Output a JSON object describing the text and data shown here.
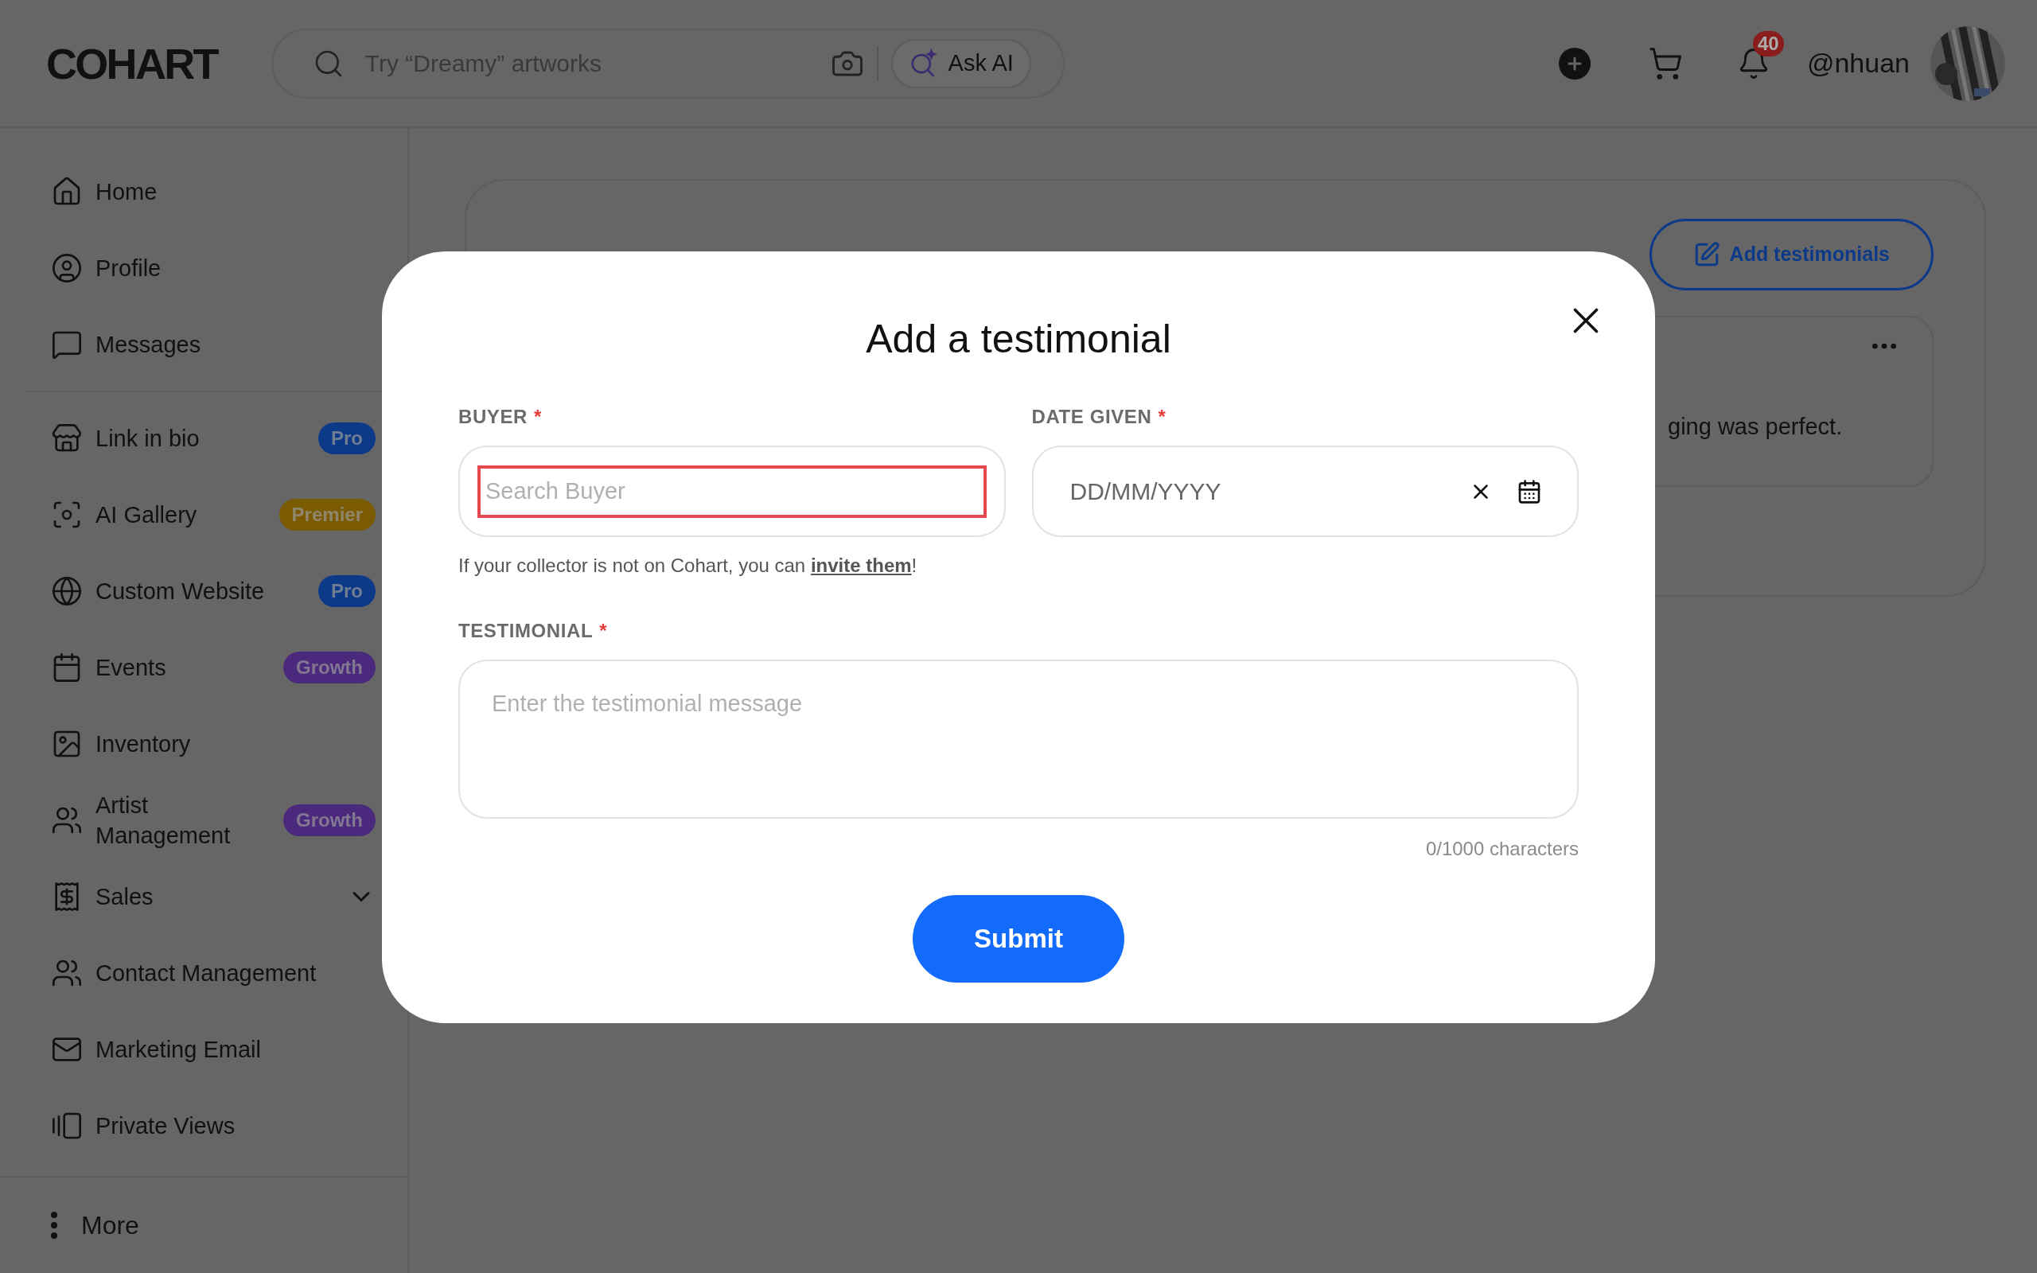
{
  "header": {
    "logo": "COHART",
    "search_placeholder": "Try “Dreamy” artworks",
    "ask_ai": "Ask AI",
    "notification_count": "40",
    "username": "@nhuan"
  },
  "sidebar": {
    "sections": [
      [
        {
          "label": "Home",
          "kind": "link"
        },
        {
          "label": "Profile",
          "kind": "link"
        },
        {
          "label": "Messages",
          "kind": "link"
        }
      ],
      [
        {
          "label": "Link in bio",
          "kind": "link",
          "badge": {
            "text": "Pro",
            "color": "#0c3a89"
          }
        },
        {
          "label": "AI Gallery",
          "kind": "link",
          "badge": {
            "text": "Premier",
            "color": "#7a5b02"
          }
        },
        {
          "label": "Custom Website",
          "kind": "link",
          "badge": {
            "text": "Pro",
            "color": "#0c3a89"
          }
        },
        {
          "label": "Events",
          "kind": "link",
          "badge": {
            "text": "Growth",
            "color": "#4b2a7e"
          }
        },
        {
          "label": "Inventory",
          "kind": "link"
        },
        {
          "label": "Artist Management",
          "kind": "link",
          "badge": {
            "text": "Growth",
            "color": "#4b2a7e"
          }
        },
        {
          "label": "Sales",
          "kind": "expandable",
          "expanded": false
        },
        {
          "label": "Contact Management",
          "kind": "link"
        },
        {
          "label": "Marketing Email",
          "kind": "link"
        },
        {
          "label": "Private Views",
          "kind": "link"
        }
      ]
    ],
    "more": "More"
  },
  "page": {
    "add_button": "Add testimonials",
    "card_text": "ging was perfect."
  },
  "modal": {
    "title": "Add a testimonial",
    "buyer": {
      "label": "BUYER",
      "marker": "*",
      "placeholder": "Search Buyer",
      "focused": true
    },
    "help": {
      "text": "If your collector is not on Cohart, you can ",
      "link": "invite them",
      "after": "!"
    },
    "date": {
      "label": "DATE GIVEN",
      "marker": "*",
      "placeholder": "DD/MM/YYYY"
    },
    "testimonial": {
      "label": "TESTIMONIAL",
      "marker": "*",
      "placeholder": "Enter the testimonial message"
    },
    "counter": "0/1000 characters",
    "submit": "Submit"
  }
}
